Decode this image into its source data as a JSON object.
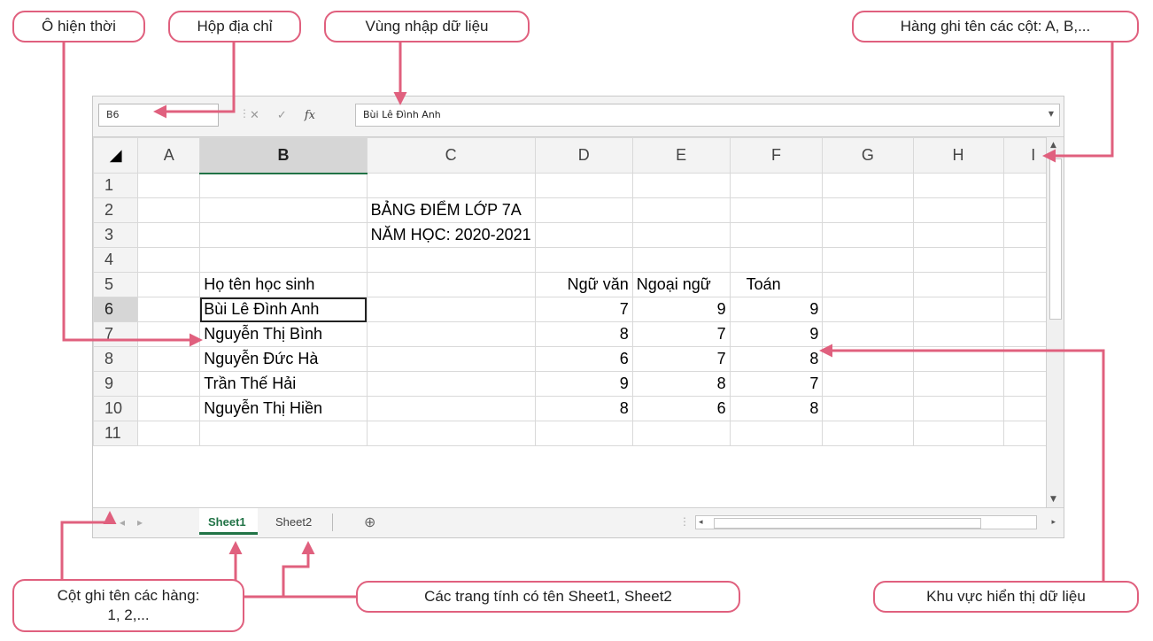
{
  "callouts": {
    "active_cell": "Ô hiện thời",
    "name_box": "Hộp địa chỉ",
    "formula_bar": "Vùng nhập dữ liệu",
    "column_headers": "Hàng ghi tên các cột: A, B,...",
    "row_headers": "Cột ghi tên các hàng:\n1, 2,...",
    "sheet_tabs": "Các trang tính có tên Sheet1, Sheet2",
    "data_area": "Khu vực hiển thị dữ liệu"
  },
  "colors": {
    "callout_border": "#e0607e",
    "arrow": "#e0607e",
    "excel_green": "#217346"
  },
  "excel": {
    "name_box": "B6",
    "formula_buttons": {
      "cancel": "✕",
      "enter": "✓",
      "fx": "fx"
    },
    "formula_value": "Bùi Lê Đình Anh",
    "columns": [
      "A",
      "B",
      "C",
      "D",
      "E",
      "F",
      "G",
      "H",
      "I"
    ],
    "rows": [
      {
        "n": "1",
        "a": "",
        "b": "",
        "c": "",
        "d": "",
        "e": "",
        "f": ""
      },
      {
        "n": "2",
        "a": "",
        "b": "",
        "c": "BẢNG ĐIỂM LỚP 7A",
        "d": "",
        "e": "",
        "f": ""
      },
      {
        "n": "3",
        "a": "",
        "b": "",
        "c": "NĂM HỌC: 2020-2021",
        "d": "",
        "e": "",
        "f": ""
      },
      {
        "n": "4",
        "a": "",
        "b": "",
        "c": "",
        "d": "",
        "e": "",
        "f": ""
      },
      {
        "n": "5",
        "a": "",
        "b": "Họ tên học sinh",
        "c": "",
        "d": "Ngữ văn",
        "e": "Ngoại ngữ",
        "f": "Toán"
      },
      {
        "n": "6",
        "a": "",
        "b": "Bùi Lê Đình Anh",
        "c": "",
        "d": "7",
        "e": "9",
        "f": "9"
      },
      {
        "n": "7",
        "a": "",
        "b": "Nguyễn Thị Bình",
        "c": "",
        "d": "8",
        "e": "7",
        "f": "9"
      },
      {
        "n": "8",
        "a": "",
        "b": "Nguyễn Đức Hà",
        "c": "",
        "d": "6",
        "e": "7",
        "f": "8"
      },
      {
        "n": "9",
        "a": "",
        "b": "Trần Thế Hải",
        "c": "",
        "d": "9",
        "e": "8",
        "f": "7"
      },
      {
        "n": "10",
        "a": "",
        "b": "Nguyễn Thị Hiền",
        "c": "",
        "d": "8",
        "e": "6",
        "f": "8"
      },
      {
        "n": "11",
        "a": "",
        "b": "",
        "c": "",
        "d": "",
        "e": "",
        "f": ""
      }
    ],
    "tabs": [
      "Sheet1",
      "Sheet2"
    ],
    "add_sheet": "⊕"
  }
}
